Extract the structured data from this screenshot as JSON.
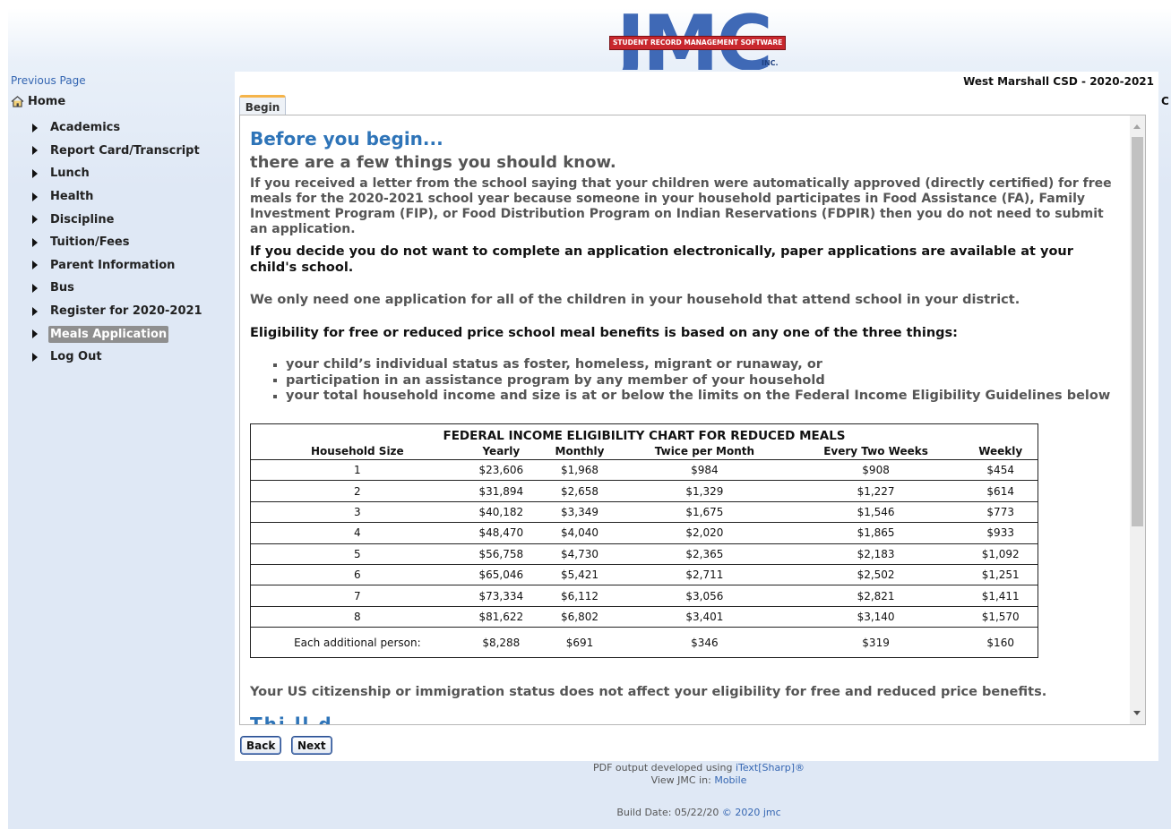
{
  "header": {
    "logo_big": "JMC",
    "logo_banner": "STUDENT RECORD MANAGEMENT SOFTWARE",
    "logo_inc": "INC."
  },
  "nav": {
    "previous_page": "Previous Page",
    "home": "Home",
    "items": [
      {
        "label": "Academics"
      },
      {
        "label": "Report Card/Transcript"
      },
      {
        "label": "Lunch"
      },
      {
        "label": "Health"
      },
      {
        "label": "Discipline"
      },
      {
        "label": "Tuition/Fees"
      },
      {
        "label": "Parent Information"
      },
      {
        "label": "Bus"
      },
      {
        "label": "Register for 2020-2021"
      },
      {
        "label": "Meals Application",
        "active": true
      },
      {
        "label": "Log Out"
      }
    ]
  },
  "district": "West Marshall CSD - 2020-2021",
  "stray_char": "C",
  "tab": "Begin",
  "content": {
    "heading": "Before you begin...",
    "subheading": "there are a few things you should know.",
    "p1": "If you received a letter from the school saying that your children were automatically approved (directly certified) for free meals for the 2020-2021 school year because someone in your household participates in Food Assistance (FA), Family Investment Program (FIP), or Food Distribution Program on Indian Reservations (FDPIR) then you do not need to submit an application.",
    "p2": "If you decide you do not want to complete an application electronically, paper applications are available at your child's school.",
    "p3": "We only need one application for all of the children in your household that attend school in your district.",
    "p4": "Eligibility for free or reduced price school meal benefits is based on any one of the three things:",
    "bullets": [
      "your child’s individual status as foster, homeless, migrant or runaway, or",
      "participation in an assistance program by any member of your household",
      "your total household income and size is at or below the limits on the Federal Income Eligibility Guidelines below"
    ],
    "citizenship": "Your US citizenship or immigration status does not affect your eligibility for free and reduced price benefits.",
    "cutoff_heading": "Thi        ll      d"
  },
  "table": {
    "title": "FEDERAL INCOME ELIGIBILITY CHART FOR REDUCED MEALS",
    "headers": [
      "Household Size",
      "Yearly",
      "Monthly",
      "Twice per Month",
      "Every Two Weeks",
      "Weekly"
    ],
    "rows": [
      [
        "1",
        "$23,606",
        "$1,968",
        "$984",
        "$908",
        "$454"
      ],
      [
        "2",
        "$31,894",
        "$2,658",
        "$1,329",
        "$1,227",
        "$614"
      ],
      [
        "3",
        "$40,182",
        "$3,349",
        "$1,675",
        "$1,546",
        "$773"
      ],
      [
        "4",
        "$48,470",
        "$4,040",
        "$2,020",
        "$1,865",
        "$933"
      ],
      [
        "5",
        "$56,758",
        "$4,730",
        "$2,365",
        "$2,183",
        "$1,092"
      ],
      [
        "6",
        "$65,046",
        "$5,421",
        "$2,711",
        "$2,502",
        "$1,251"
      ],
      [
        "7",
        "$73,334",
        "$6,112",
        "$3,056",
        "$2,821",
        "$1,411"
      ],
      [
        "8",
        "$81,622",
        "$6,802",
        "$3,401",
        "$3,140",
        "$1,570"
      ],
      [
        "Each additional person:",
        "$8,288",
        "$691",
        "$346",
        "$319",
        "$160"
      ]
    ]
  },
  "buttons": {
    "back": "Back",
    "next": "Next"
  },
  "footer": {
    "pdf_prefix": "PDF output developed using ",
    "pdf_link": "iText[Sharp]®",
    "view_prefix": "View JMC in: ",
    "view_link": "Mobile",
    "build_prefix": "Build Date: 05/22/20 ",
    "build_link": "© 2020 jmc"
  }
}
